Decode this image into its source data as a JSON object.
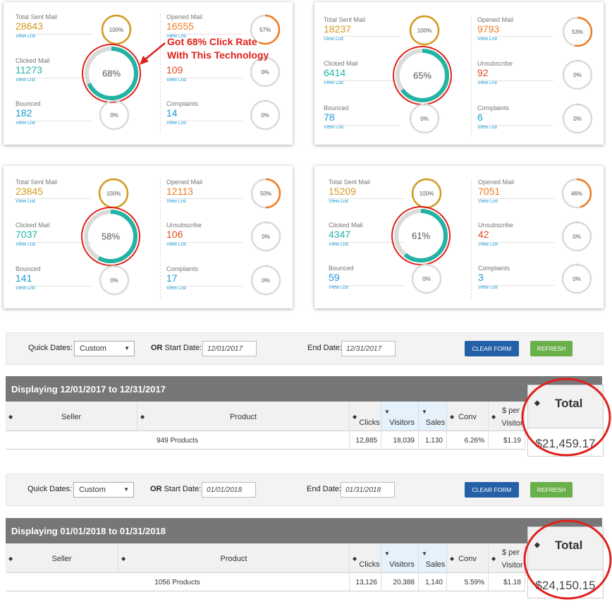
{
  "cards": [
    {
      "total_sent": {
        "label": "Total Sent Mail",
        "value": "28643",
        "link": "View List",
        "pct": "100%"
      },
      "opened": {
        "label": "Opened Mail",
        "value": "16555",
        "link": "View List",
        "pct": "57%"
      },
      "clicked": {
        "label": "Clicked Mail",
        "value": "11273",
        "link": "View List",
        "pct": "68%"
      },
      "unsubscribe": {
        "label": "",
        "value": "109",
        "link": "View List",
        "pct": "0%"
      },
      "bounced": {
        "label": "Bounced",
        "value": "182",
        "link": "View List",
        "pct": "0%"
      },
      "complaints": {
        "label": "Complaints",
        "value": "14",
        "link": "View List",
        "pct": "0%"
      }
    },
    {
      "total_sent": {
        "label": "Total Sent Mail",
        "value": "18237",
        "link": "View List",
        "pct": "100%"
      },
      "opened": {
        "label": "Opened Mail",
        "value": "9793",
        "link": "View List",
        "pct": "53%"
      },
      "clicked": {
        "label": "Clicked Mail",
        "value": "6414",
        "link": "View List",
        "pct": "65%"
      },
      "unsubscribe": {
        "label": "Unsubscribe",
        "value": "92",
        "link": "View List",
        "pct": "0%"
      },
      "bounced": {
        "label": "Bounced",
        "value": "78",
        "link": "View List",
        "pct": "0%"
      },
      "complaints": {
        "label": "Complaints",
        "value": "6",
        "link": "View List",
        "pct": "0%"
      }
    },
    {
      "total_sent": {
        "label": "Total Sent Mail",
        "value": "23845",
        "link": "View List",
        "pct": "100%"
      },
      "opened": {
        "label": "Opened Mail",
        "value": "12113",
        "link": "View List",
        "pct": "50%"
      },
      "clicked": {
        "label": "Clicked Mail",
        "value": "7037",
        "link": "View List",
        "pct": "58%"
      },
      "unsubscribe": {
        "label": "Unsubscribe",
        "value": "106",
        "link": "View List",
        "pct": "0%"
      },
      "bounced": {
        "label": "Bounced",
        "value": "141",
        "link": "View List",
        "pct": "0%"
      },
      "complaints": {
        "label": "Complaints",
        "value": "17",
        "link": "View List",
        "pct": "0%"
      }
    },
    {
      "total_sent": {
        "label": "Total Sent Mail",
        "value": "15209",
        "link": "View List",
        "pct": "100%"
      },
      "opened": {
        "label": "Opened Mail",
        "value": "7051",
        "link": "View List",
        "pct": "46%"
      },
      "clicked": {
        "label": "Clicked Mail",
        "value": "4347",
        "link": "View List",
        "pct": "61%"
      },
      "unsubscribe": {
        "label": "Unsubscribe",
        "value": "42",
        "link": "View List",
        "pct": "0%"
      },
      "bounced": {
        "label": "Bounced",
        "value": "59",
        "link": "View List",
        "pct": "0%"
      },
      "complaints": {
        "label": "Complaints",
        "value": "3",
        "link": "View List",
        "pct": "0%"
      }
    }
  ],
  "callout": {
    "line1": "Got 68% Click Rate",
    "line2": "With This Technology"
  },
  "reports": [
    {
      "form": {
        "quick_dates_label": "Quick Dates:",
        "quick_dates_value": "Custom",
        "or_label": "OR",
        "start_label": "Start Date:",
        "start_value": "12/01/2017",
        "end_label": "End Date:",
        "end_value": "12/31/2017",
        "clear_label": "CLEAR FORM",
        "refresh_label": "REFRESH"
      },
      "displaying": "Displaying 12/01/2017 to 12/31/2017",
      "columns": {
        "seller": "Seller",
        "product": "Product",
        "clicks": "Clicks",
        "visitors": "Visitors",
        "sales": "Sales",
        "conv": "Conv",
        "per_visitor_1": "$ per",
        "per_visitor_2": "Visitor",
        "total": "Total"
      },
      "row": {
        "products": "949 Products",
        "clicks": "12,885",
        "visitors": "18,039",
        "sales": "1,130",
        "conv": "6.26%",
        "per_visitor": "$1.19",
        "total": "$21,459.17"
      }
    },
    {
      "form": {
        "quick_dates_label": "Quick Dates:",
        "quick_dates_value": "Custom",
        "or_label": "OR",
        "start_label": "Start Date:",
        "start_value": "01/01/2018",
        "end_label": "End Date:",
        "end_value": "01/31/2018",
        "clear_label": "CLEAR FORM",
        "refresh_label": "REFRESH"
      },
      "displaying": "Displaying 01/01/2018 to 01/31/2018",
      "columns": {
        "seller": "Seller",
        "product": "Product",
        "clicks": "Clicks",
        "visitors": "Visitors",
        "sales": "Sales",
        "conv": "Conv",
        "per_visitor_1": "$ per",
        "per_visitor_2": "Visitor",
        "total": "Total"
      },
      "row": {
        "products": "1056 Products",
        "clicks": "13,126",
        "visitors": "20,388",
        "sales": "1,140",
        "conv": "5.59%",
        "per_visitor": "$1.18",
        "total": "$24,150.15"
      }
    }
  ],
  "colors": {
    "gold": "#d39a1f",
    "orange": "#f07a21",
    "teal": "#23b3a4",
    "blue": "#1a9ad6",
    "red_mark": "#e0201b",
    "clear_btn": "#2360a8",
    "refresh_btn": "#6ab04a"
  }
}
